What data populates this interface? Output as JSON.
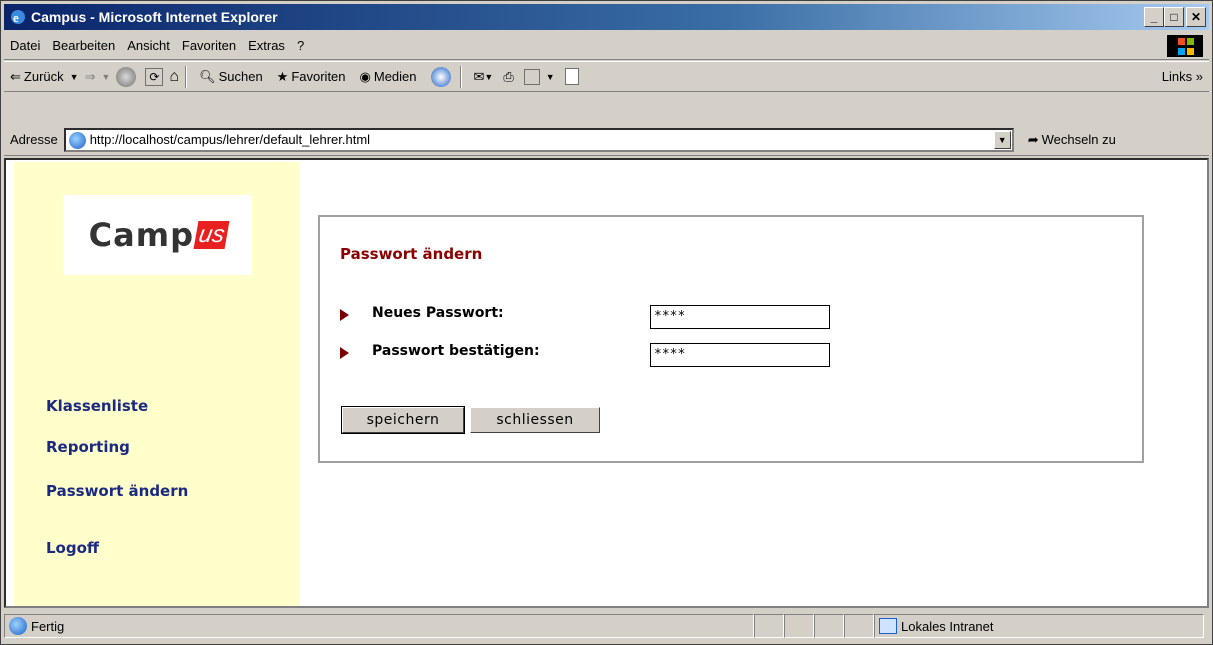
{
  "window": {
    "title": "Campus - Microsoft Internet Explorer"
  },
  "menubar": {
    "items": [
      "Datei",
      "Bearbeiten",
      "Ansicht",
      "Favoriten",
      "Extras",
      "?"
    ]
  },
  "toolbar": {
    "back_label": "Zurück",
    "search_label": "Suchen",
    "favorites_label": "Favoriten",
    "media_label": "Medien",
    "links_label": "Links"
  },
  "addressbar": {
    "label": "Adresse",
    "url": "http://localhost/campus/lehrer/default_lehrer.html",
    "go_label": "Wechseln zu"
  },
  "sidebar": {
    "logo_text": "Camp",
    "logo_suffix": "us",
    "nav": [
      "Klassenliste",
      "Reporting",
      "Passwort ändern",
      "Logoff"
    ]
  },
  "panel": {
    "title": "Passwort ändern",
    "new_password_label": "Neues Passwort:",
    "new_password_value": "****",
    "confirm_password_label": "Passwort bestätigen:",
    "confirm_password_value": "****",
    "save_label": "speichern",
    "close_label": "schliessen"
  },
  "statusbar": {
    "status": "Fertig",
    "zone": "Lokales Intranet"
  },
  "colors": {
    "sidebar_bg": "#ffffcc",
    "nav_link": "#1b2a80",
    "panel_title": "#8b0000",
    "titlebar_start": "#0a246a"
  }
}
